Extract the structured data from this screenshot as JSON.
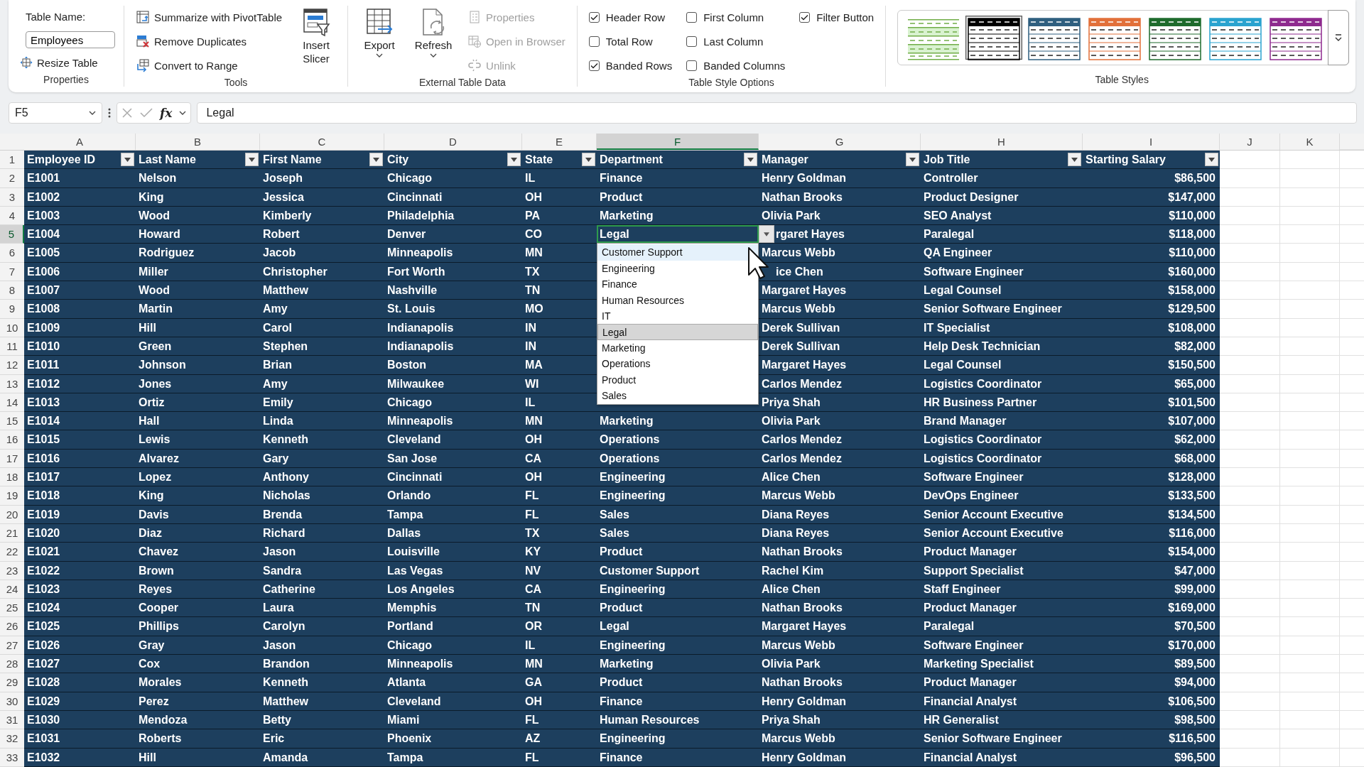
{
  "ribbon": {
    "groups": [
      {
        "label": "Properties",
        "items": [
          {
            "kind": "label",
            "text": "Table Name:"
          },
          {
            "kind": "field",
            "value": "Employees"
          },
          {
            "kind": "small",
            "label": "Resize Table",
            "disabled": false
          }
        ]
      },
      {
        "label": "Tools",
        "items": [
          {
            "kind": "small",
            "label": "Summarize with PivotTable",
            "disabled": false
          },
          {
            "kind": "small",
            "label": "Remove Duplicates",
            "disabled": false
          },
          {
            "kind": "small",
            "label": "Convert to Range",
            "disabled": false
          },
          {
            "kind": "large",
            "label": "Insert Slicer",
            "menu": false,
            "disabled": false
          }
        ]
      },
      {
        "label": "External Table Data",
        "items": [
          {
            "kind": "large",
            "label": "Export",
            "menu": true,
            "disabled": false
          },
          {
            "kind": "large",
            "label": "Refresh",
            "menu": true,
            "disabled": false
          },
          {
            "kind": "small",
            "label": "Properties",
            "disabled": true
          },
          {
            "kind": "small",
            "label": "Open in Browser",
            "disabled": true
          },
          {
            "kind": "small",
            "label": "Unlink",
            "disabled": true
          }
        ]
      },
      {
        "label": "Table Style Options",
        "items": [
          {
            "kind": "checkbox",
            "label": "Header Row",
            "checked": true
          },
          {
            "kind": "checkbox",
            "label": "Total Row",
            "checked": false
          },
          {
            "kind": "checkbox",
            "label": "Banded Rows",
            "checked": true
          },
          {
            "kind": "checkbox",
            "label": "First Column",
            "checked": false
          },
          {
            "kind": "checkbox",
            "label": "Last Column",
            "checked": false
          },
          {
            "kind": "checkbox",
            "label": "Banded Columns",
            "checked": false
          },
          {
            "kind": "checkbox",
            "label": "Filter Button",
            "checked": true
          }
        ]
      },
      {
        "label": "Table Styles",
        "items": [
          {
            "kind": "gallery",
            "styles": [
              {
                "kind": "light",
                "color": "#70ad47",
                "selected": false
              },
              {
                "kind": "medium",
                "color": "#000000",
                "selected": true
              },
              {
                "kind": "medium",
                "color": "#2f5f7f",
                "selected": false
              },
              {
                "kind": "medium",
                "color": "#e2703a",
                "selected": false
              },
              {
                "kind": "medium",
                "color": "#1e6b2c",
                "selected": false
              },
              {
                "kind": "medium",
                "color": "#2aa3cf",
                "selected": false
              },
              {
                "kind": "medium",
                "color": "#8e2a8e",
                "selected": false
              }
            ]
          }
        ]
      }
    ]
  },
  "formula_bar": {
    "name_box": "F5",
    "function_label": "fx",
    "formula": "Legal"
  },
  "sheet": {
    "columns": [
      {
        "label": "A",
        "selected": false
      },
      {
        "label": "B",
        "selected": false
      },
      {
        "label": "C",
        "selected": false
      },
      {
        "label": "D",
        "selected": false
      },
      {
        "label": "E",
        "selected": false
      },
      {
        "label": "F",
        "selected": true
      },
      {
        "label": "G",
        "selected": false
      },
      {
        "label": "H",
        "selected": false
      },
      {
        "label": "I",
        "selected": false
      },
      {
        "label": "J",
        "selected": false
      },
      {
        "label": "K",
        "selected": false
      }
    ],
    "header_row": {
      "number": "1",
      "cells": [
        "Employee ID",
        "Last Name",
        "First Name",
        "City",
        "State",
        "Department",
        "Manager",
        "Job Title",
        "Starting Salary"
      ]
    },
    "rows": [
      {
        "number": "2",
        "selected": false,
        "cells": [
          "E1001",
          "Nelson",
          "Joseph",
          "Chicago",
          "IL",
          "Finance",
          "Henry Goldman",
          "Controller",
          "$86,500"
        ]
      },
      {
        "number": "3",
        "selected": false,
        "cells": [
          "E1002",
          "King",
          "Jessica",
          "Cincinnati",
          "OH",
          "Product",
          "Nathan Brooks",
          "Product Designer",
          "$147,000"
        ]
      },
      {
        "number": "4",
        "selected": false,
        "cells": [
          "E1003",
          "Wood",
          "Kimberly",
          "Philadelphia",
          "PA",
          "Marketing",
          "Olivia Park",
          "SEO Analyst",
          "$110,000"
        ]
      },
      {
        "number": "5",
        "selected": true,
        "cells": [
          "E1004",
          "Howard",
          "Robert",
          "Denver",
          "CO",
          {
            "text": "Legal",
            "active": true
          },
          {
            "text": "rgaret Hayes",
            "kind": "covered"
          },
          "Paralegal",
          "$118,000"
        ]
      },
      {
        "number": "6",
        "selected": false,
        "cells": [
          "E1005",
          "Rodriguez",
          "Jacob",
          "Minneapolis",
          "MN",
          null,
          "Marcus Webb",
          "QA Engineer",
          "$110,000"
        ]
      },
      {
        "number": "7",
        "selected": false,
        "cells": [
          "E1006",
          "Miller",
          "Christopher",
          "Fort Worth",
          "TX",
          null,
          {
            "text": "ice Chen",
            "kind": "covered"
          },
          "Software Engineer",
          "$160,000"
        ]
      },
      {
        "number": "8",
        "selected": false,
        "cells": [
          "E1007",
          "Wood",
          "Matthew",
          "Nashville",
          "TN",
          null,
          "Margaret Hayes",
          "Legal Counsel",
          "$158,000"
        ]
      },
      {
        "number": "9",
        "selected": false,
        "cells": [
          "E1008",
          "Martin",
          "Amy",
          "St. Louis",
          "MO",
          null,
          "Marcus Webb",
          "Senior Software Engineer",
          "$129,500"
        ]
      },
      {
        "number": "10",
        "selected": false,
        "cells": [
          "E1009",
          "Hill",
          "Carol",
          "Indianapolis",
          "IN",
          null,
          "Derek Sullivan",
          "IT Specialist",
          "$108,000"
        ]
      },
      {
        "number": "11",
        "selected": false,
        "cells": [
          "E1010",
          "Green",
          "Stephen",
          "Indianapolis",
          "IN",
          null,
          "Derek Sullivan",
          "Help Desk Technician",
          "$82,000"
        ]
      },
      {
        "number": "12",
        "selected": false,
        "cells": [
          "E1011",
          "Johnson",
          "Brian",
          "Boston",
          "MA",
          null,
          "Margaret Hayes",
          "Legal Counsel",
          "$150,500"
        ]
      },
      {
        "number": "13",
        "selected": false,
        "cells": [
          "E1012",
          "Jones",
          "Amy",
          "Milwaukee",
          "WI",
          null,
          "Carlos Mendez",
          "Logistics Coordinator",
          "$65,000"
        ]
      },
      {
        "number": "14",
        "selected": false,
        "cells": [
          "E1013",
          "Ortiz",
          "Emily",
          "Chicago",
          "IL",
          null,
          "Priya Shah",
          "HR Business Partner",
          "$101,500"
        ]
      },
      {
        "number": "15",
        "selected": false,
        "cells": [
          "E1014",
          "Hall",
          "Linda",
          "Minneapolis",
          "MN",
          "Marketing",
          "Olivia Park",
          "Brand Manager",
          "$107,000"
        ]
      },
      {
        "number": "16",
        "selected": false,
        "cells": [
          "E1015",
          "Lewis",
          "Kenneth",
          "Cleveland",
          "OH",
          "Operations",
          "Carlos Mendez",
          "Logistics Coordinator",
          "$62,000"
        ]
      },
      {
        "number": "17",
        "selected": false,
        "cells": [
          "E1016",
          "Alvarez",
          "Gary",
          "San Jose",
          "CA",
          "Operations",
          "Carlos Mendez",
          "Logistics Coordinator",
          "$68,000"
        ]
      },
      {
        "number": "18",
        "selected": false,
        "cells": [
          "E1017",
          "Lopez",
          "Anthony",
          "Cincinnati",
          "OH",
          "Engineering",
          "Alice Chen",
          "Software Engineer",
          "$128,000"
        ]
      },
      {
        "number": "19",
        "selected": false,
        "cells": [
          "E1018",
          "King",
          "Nicholas",
          "Orlando",
          "FL",
          "Engineering",
          "Marcus Webb",
          "DevOps Engineer",
          "$133,500"
        ]
      },
      {
        "number": "20",
        "selected": false,
        "cells": [
          "E1019",
          "Davis",
          "Brenda",
          "Tampa",
          "FL",
          "Sales",
          "Diana Reyes",
          "Senior Account Executive",
          "$134,500"
        ]
      },
      {
        "number": "21",
        "selected": false,
        "cells": [
          "E1020",
          "Diaz",
          "Richard",
          "Dallas",
          "TX",
          "Sales",
          "Diana Reyes",
          "Senior Account Executive",
          "$116,000"
        ]
      },
      {
        "number": "22",
        "selected": false,
        "cells": [
          "E1021",
          "Chavez",
          "Jason",
          "Louisville",
          "KY",
          "Product",
          "Nathan Brooks",
          "Product Manager",
          "$154,000"
        ]
      },
      {
        "number": "23",
        "selected": false,
        "cells": [
          "E1022",
          "Brown",
          "Sandra",
          "Las Vegas",
          "NV",
          "Customer Support",
          "Rachel Kim",
          "Support Specialist",
          "$47,000"
        ]
      },
      {
        "number": "24",
        "selected": false,
        "cells": [
          "E1023",
          "Reyes",
          "Catherine",
          "Los Angeles",
          "CA",
          "Engineering",
          "Alice Chen",
          "Staff Engineer",
          "$99,000"
        ]
      },
      {
        "number": "25",
        "selected": false,
        "cells": [
          "E1024",
          "Cooper",
          "Laura",
          "Memphis",
          "TN",
          "Product",
          "Nathan Brooks",
          "Product Manager",
          "$169,000"
        ]
      },
      {
        "number": "26",
        "selected": false,
        "cells": [
          "E1025",
          "Phillips",
          "Carolyn",
          "Portland",
          "OR",
          "Legal",
          "Margaret Hayes",
          "Paralegal",
          "$70,500"
        ]
      },
      {
        "number": "27",
        "selected": false,
        "cells": [
          "E1026",
          "Gray",
          "Jason",
          "Chicago",
          "IL",
          "Engineering",
          "Marcus Webb",
          "Software Engineer",
          "$170,000"
        ]
      },
      {
        "number": "28",
        "selected": false,
        "cells": [
          "E1027",
          "Cox",
          "Brandon",
          "Minneapolis",
          "MN",
          "Marketing",
          "Olivia Park",
          "Marketing Specialist",
          "$89,500"
        ]
      },
      {
        "number": "29",
        "selected": false,
        "cells": [
          "E1028",
          "Morales",
          "Kenneth",
          "Atlanta",
          "GA",
          "Product",
          "Nathan Brooks",
          "Product Manager",
          "$94,000"
        ]
      },
      {
        "number": "30",
        "selected": false,
        "cells": [
          "E1029",
          "Perez",
          "Matthew",
          "Cleveland",
          "OH",
          "Finance",
          "Henry Goldman",
          "Financial Analyst",
          "$106,500"
        ]
      },
      {
        "number": "31",
        "selected": false,
        "cells": [
          "E1030",
          "Mendoza",
          "Betty",
          "Miami",
          "FL",
          "Human Resources",
          "Priya Shah",
          "HR Generalist",
          "$98,500"
        ]
      },
      {
        "number": "32",
        "selected": false,
        "cells": [
          "E1031",
          "Roberts",
          "Eric",
          "Phoenix",
          "AZ",
          "Engineering",
          "Marcus Webb",
          "Senior Software Engineer",
          "$116,500"
        ]
      },
      {
        "number": "33",
        "selected": false,
        "cells": [
          "E1032",
          "Hill",
          "Amanda",
          "Tampa",
          "FL",
          "Finance",
          "Henry Goldman",
          "Financial Analyst",
          "$96,500"
        ]
      }
    ],
    "dropdown": {
      "items": [
        {
          "label": "Customer Support",
          "hovered": true,
          "selected": false
        },
        {
          "label": "Engineering",
          "hovered": false,
          "selected": false
        },
        {
          "label": "Finance",
          "hovered": false,
          "selected": false
        },
        {
          "label": "Human Resources",
          "hovered": false,
          "selected": false
        },
        {
          "label": "IT",
          "hovered": false,
          "selected": false
        },
        {
          "label": "Legal",
          "hovered": false,
          "selected": true
        },
        {
          "label": "Marketing",
          "hovered": false,
          "selected": false
        },
        {
          "label": "Operations",
          "hovered": false,
          "selected": false
        },
        {
          "label": "Product",
          "hovered": false,
          "selected": false
        },
        {
          "label": "Sales",
          "hovered": false,
          "selected": false
        }
      ]
    }
  }
}
